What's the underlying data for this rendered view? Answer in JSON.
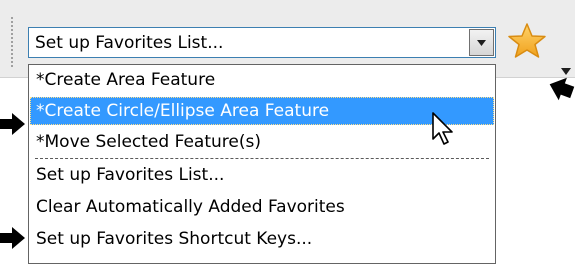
{
  "toolbar": {
    "combo_value": "Set up Favorites List...",
    "favorites_icon": "star-icon",
    "favorites_menu_icon": "chevron-down-icon"
  },
  "dropdown": {
    "items": [
      {
        "label": "*Create Area Feature",
        "selected": false
      },
      {
        "label": "*Create Circle/Ellipse Area Feature",
        "selected": true
      },
      {
        "label": "*Move Selected Feature(s)",
        "selected": false
      },
      {
        "label": "Set up Favorites List...",
        "selected": false
      },
      {
        "label": "Clear Automatically Added Favorites",
        "selected": false
      },
      {
        "label": "Set up Favorites Shortcut Keys...",
        "selected": false
      }
    ]
  },
  "colors": {
    "selection": "#3399ff",
    "combo_border": "#3c7fb1",
    "star_fill": "#f5b336"
  },
  "callouts": [
    "callout-arrow",
    "callout-arrow",
    "callout-arrow"
  ]
}
